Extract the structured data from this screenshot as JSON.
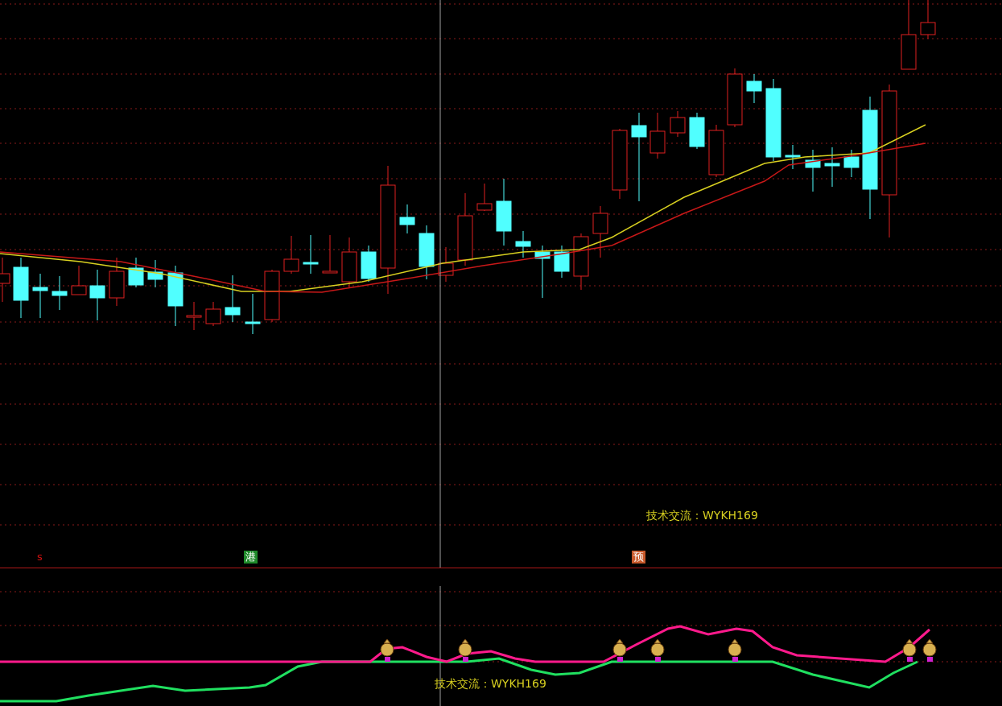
{
  "main_chart": {
    "caption": "技术交流：WYKH169",
    "markers": [
      {
        "text": "s",
        "kind": "plain",
        "color": "#d01010"
      },
      {
        "text": "港",
        "kind": "tag",
        "color": "#1f8a2a"
      },
      {
        "text": "预",
        "kind": "tag",
        "color": "#c8582a"
      }
    ]
  },
  "sub_chart": {
    "caption": "技术交流：WYKH169"
  }
}
